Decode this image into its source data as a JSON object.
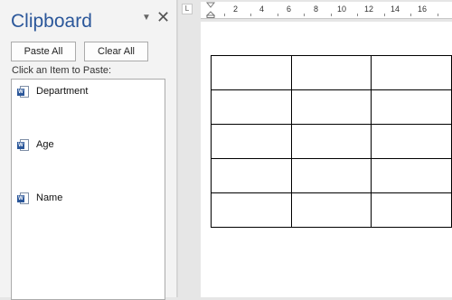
{
  "pane": {
    "title": "Clipboard",
    "menu_icon": "dropdown-arrow",
    "close_icon": "close-x",
    "paste_all_label": "Paste All",
    "clear_all_label": "Clear All",
    "instruction": "Click an Item to Paste:",
    "items": [
      {
        "label": "Department",
        "icon": "word-doc-icon"
      },
      {
        "label": "Age",
        "icon": "word-doc-icon"
      },
      {
        "label": "Name",
        "icon": "word-doc-icon"
      }
    ]
  },
  "ruler": {
    "corner_glyph": "L",
    "numbers": [
      "2",
      "4",
      "6",
      "8",
      "10",
      "12",
      "14",
      "16"
    ]
  },
  "document": {
    "table": {
      "rows": 5,
      "visible_columns": 3,
      "cells": [
        [
          "",
          "",
          ""
        ],
        [
          "",
          "",
          ""
        ],
        [
          "",
          "",
          ""
        ],
        [
          "",
          "",
          ""
        ],
        [
          "",
          "",
          ""
        ]
      ]
    }
  },
  "colors": {
    "accent": "#2b579a",
    "pane_bg": "#f3f3f3",
    "doc_bg": "#e6e6e6"
  }
}
